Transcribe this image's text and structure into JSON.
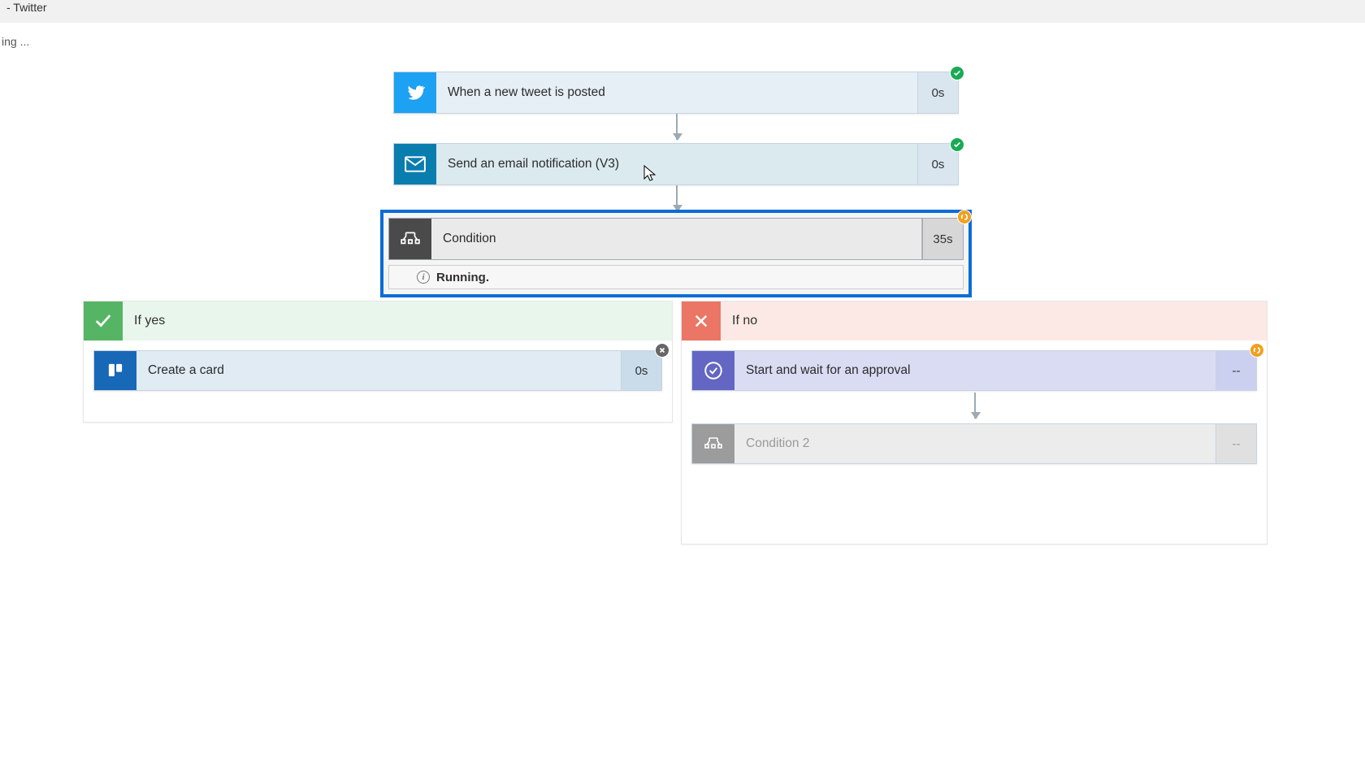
{
  "tab_suffix": "- Twitter",
  "loading_text": "ing ...",
  "trigger": {
    "title": "When a new tweet is posted",
    "duration": "0s",
    "status": "success"
  },
  "email_step": {
    "title": "Send an email notification (V3)",
    "duration": "0s",
    "status": "success"
  },
  "condition": {
    "title": "Condition",
    "duration": "35s",
    "status": "running",
    "message": "Running."
  },
  "branches": {
    "yes": {
      "label": "If yes",
      "steps": [
        {
          "id": "create-card",
          "title": "Create a card",
          "duration": "0s",
          "status": "cancel"
        }
      ]
    },
    "no": {
      "label": "If no",
      "steps": [
        {
          "id": "approval",
          "title": "Start and wait for an approval",
          "duration": "--",
          "status": "running"
        },
        {
          "id": "condition2",
          "title": "Condition 2",
          "duration": "--",
          "status": "none"
        }
      ]
    }
  }
}
